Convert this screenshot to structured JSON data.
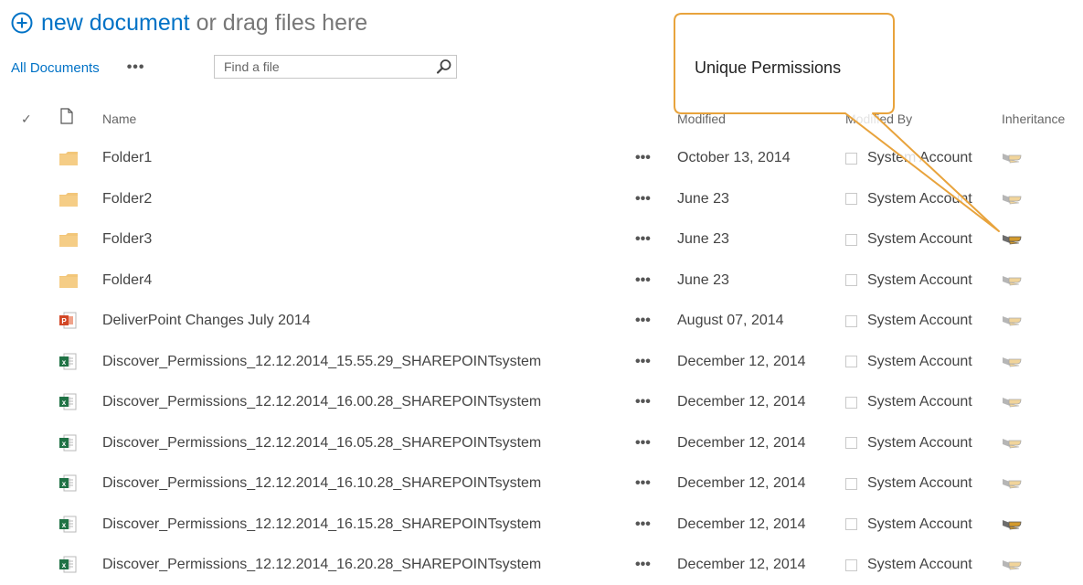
{
  "toolbar": {
    "new_document_label": "new document",
    "drag_text": "or drag files here",
    "view_label": "All Documents",
    "more_label": "•••",
    "search_placeholder": "Find a file"
  },
  "columns": {
    "check": "✓",
    "name": "Name",
    "modified": "Modified",
    "modified_by": "Modified By",
    "inheritance": "Inheritance"
  },
  "callout": {
    "text": "Unique Permissions",
    "border_color": "#e8a33c"
  },
  "colors": {
    "link": "#0072c6",
    "folder": "#f2c679",
    "excel": "#207245",
    "powerpoint": "#d24726"
  },
  "rows": [
    {
      "type": "folder",
      "icon": "folder-icon",
      "name": "Folder1",
      "ellipsis": "•••",
      "modified": "October 13, 2014",
      "modified_by": "System Account",
      "unique": false
    },
    {
      "type": "folder",
      "icon": "folder-icon",
      "name": "Folder2",
      "ellipsis": "•••",
      "modified": "June 23",
      "modified_by": "System Account",
      "unique": false
    },
    {
      "type": "folder",
      "icon": "folder-icon",
      "name": "Folder3",
      "ellipsis": "•••",
      "modified": "June 23",
      "modified_by": "System Account",
      "unique": true
    },
    {
      "type": "folder",
      "icon": "folder-icon",
      "name": "Folder4",
      "ellipsis": "•••",
      "modified": "June 23",
      "modified_by": "System Account",
      "unique": false
    },
    {
      "type": "pptx",
      "icon": "powerpoint-icon",
      "name": "DeliverPoint Changes July 2014",
      "ellipsis": "•••",
      "modified": "August 07, 2014",
      "modified_by": "System Account",
      "unique": false
    },
    {
      "type": "xlsx",
      "icon": "excel-icon",
      "name": "Discover_Permissions_12.12.2014_15.55.29_SHAREPOINTsystem",
      "ellipsis": "•••",
      "modified": "December 12, 2014",
      "modified_by": "System Account",
      "unique": false
    },
    {
      "type": "xlsx",
      "icon": "excel-icon",
      "name": "Discover_Permissions_12.12.2014_16.00.28_SHAREPOINTsystem",
      "ellipsis": "•••",
      "modified": "December 12, 2014",
      "modified_by": "System Account",
      "unique": false
    },
    {
      "type": "xlsx",
      "icon": "excel-icon",
      "name": "Discover_Permissions_12.12.2014_16.05.28_SHAREPOINTsystem",
      "ellipsis": "•••",
      "modified": "December 12, 2014",
      "modified_by": "System Account",
      "unique": false
    },
    {
      "type": "xlsx",
      "icon": "excel-icon",
      "name": "Discover_Permissions_12.12.2014_16.10.28_SHAREPOINTsystem",
      "ellipsis": "•••",
      "modified": "December 12, 2014",
      "modified_by": "System Account",
      "unique": false
    },
    {
      "type": "xlsx",
      "icon": "excel-icon",
      "name": "Discover_Permissions_12.12.2014_16.15.28_SHAREPOINTsystem",
      "ellipsis": "•••",
      "modified": "December 12, 2014",
      "modified_by": "System Account",
      "unique": true
    },
    {
      "type": "xlsx",
      "icon": "excel-icon",
      "name": "Discover_Permissions_12.12.2014_16.20.28_SHAREPOINTsystem",
      "ellipsis": "•••",
      "modified": "December 12, 2014",
      "modified_by": "System Account",
      "unique": false
    }
  ]
}
